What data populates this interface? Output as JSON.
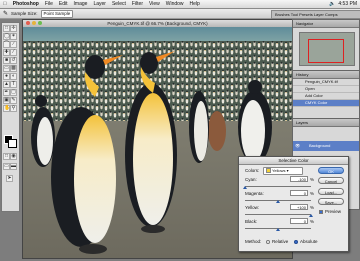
{
  "menubar": {
    "apple": "",
    "items": [
      "Photoshop",
      "File",
      "Edit",
      "Image",
      "Layer",
      "Select",
      "Filter",
      "View",
      "Window",
      "Help"
    ],
    "clock": "4:53 PM"
  },
  "options_bar": {
    "sample_size_label": "Sample Size:",
    "sample_size_value": "Point Sample"
  },
  "palette_well": {
    "label": "Brushes  Tool Presets  Layer Comps"
  },
  "document": {
    "title": "Penguin_CMYK.tif @ 66.7% (Background, CMYK)"
  },
  "palettes": {
    "navigator_tab": "Navigator",
    "history_tab": "History",
    "history_items": [
      "Penguin_CMYK.tif",
      "Open",
      "Add Color",
      "CMYK Color"
    ],
    "history_selected": 3,
    "layers_tab": "Layers",
    "layer_name": "Background"
  },
  "dialog": {
    "title": "Selective Color",
    "colors_label": "Colors:",
    "colors_value": "Yellows",
    "sliders": [
      {
        "label": "Cyan:",
        "value": "-100",
        "pct": "%",
        "level": 0.0
      },
      {
        "label": "Magenta:",
        "value": "0",
        "pct": "%",
        "level": 0.5
      },
      {
        "label": "Yellow:",
        "value": "+100",
        "pct": "%",
        "level": 1.0
      },
      {
        "label": "Black:",
        "value": "0",
        "pct": "%",
        "level": 0.5
      }
    ],
    "method_label": "Method:",
    "method_options": [
      "Relative",
      "Absolute"
    ],
    "method_selected": "Absolute",
    "buttons": {
      "ok": "OK",
      "cancel": "Cancel",
      "load": "Load...",
      "save": "Save..."
    },
    "preview_label": "Preview"
  },
  "colors": {
    "accent": "#3a6fd0",
    "penguin_body": "#f2f2ee",
    "penguin_yellow": "#f4c23a",
    "penguin_black": "#1a1d22"
  }
}
